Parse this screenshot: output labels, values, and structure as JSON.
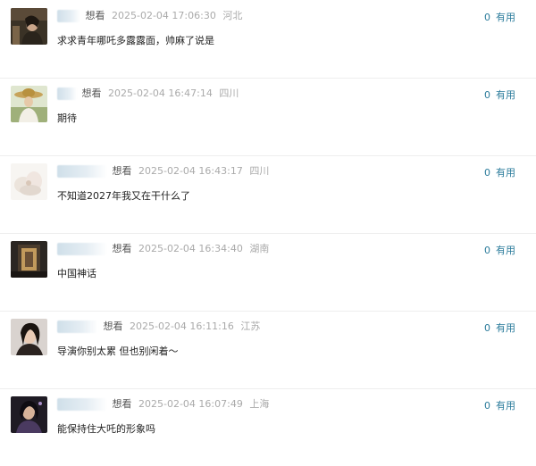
{
  "comments": [
    {
      "username": "",
      "status": "想看",
      "time": "2025-02-04 17:06:30",
      "location": "河北",
      "content": "求求青年哪吒多露露面，帅麻了说是",
      "votes": "0",
      "vote_label": "有用"
    },
    {
      "username": "",
      "status": "想看",
      "time": "2025-02-04 16:47:14",
      "location": "四川",
      "content": "期待",
      "votes": "0",
      "vote_label": "有用"
    },
    {
      "username": "",
      "status": "想看",
      "time": "2025-02-04 16:43:17",
      "location": "四川",
      "content": "不知道2027年我又在干什么了",
      "votes": "0",
      "vote_label": "有用"
    },
    {
      "username": "",
      "status": "想看",
      "time": "2025-02-04 16:34:40",
      "location": "湖南",
      "content": "中国神话",
      "votes": "0",
      "vote_label": "有用"
    },
    {
      "username": "",
      "status": "想看",
      "time": "2025-02-04 16:11:16",
      "location": "江苏",
      "content": "导演你别太累 但也别闲着～",
      "votes": "0",
      "vote_label": "有用"
    },
    {
      "username": "",
      "status": "想看",
      "time": "2025-02-04 16:07:49",
      "location": "上海",
      "content": "能保持住大吒的形象吗",
      "votes": "0",
      "vote_label": "有用"
    }
  ]
}
